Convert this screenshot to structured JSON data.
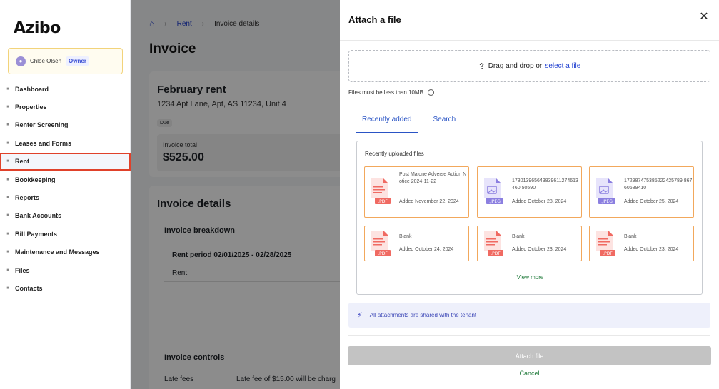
{
  "sidebar": {
    "logo": "Azibo",
    "user": {
      "name": "Chloe Olsen",
      "role": "Owner",
      "avatar_icon": "user-avatar-icon"
    },
    "items": [
      {
        "label": "Dashboard",
        "icon": "home-icon"
      },
      {
        "label": "Properties",
        "icon": "building-icon"
      },
      {
        "label": "Renter Screening",
        "icon": "user-search-icon"
      },
      {
        "label": "Leases and Forms",
        "icon": "document-icon"
      },
      {
        "label": "Rent",
        "icon": "chart-icon",
        "active": true
      },
      {
        "label": "Bookkeeping",
        "icon": "ledger-icon"
      },
      {
        "label": "Reports",
        "icon": "report-icon"
      },
      {
        "label": "Bank Accounts",
        "icon": "bank-icon"
      },
      {
        "label": "Bill Payments",
        "icon": "bill-icon"
      },
      {
        "label": "Maintenance and Messages",
        "icon": "wrench-icon"
      },
      {
        "label": "Files",
        "icon": "folder-icon"
      },
      {
        "label": "Contacts",
        "icon": "contacts-icon"
      }
    ]
  },
  "main": {
    "breadcrumb": {
      "home_icon": "home-icon",
      "rent": "Rent",
      "current": "Invoice details"
    },
    "page_title": "Invoice",
    "summary": {
      "title": "February rent",
      "address": "1234 Apt Lane, Apt, AS 11234, Unit 4",
      "status": "Due",
      "total_label": "Invoice total",
      "total_value": "$525.00"
    },
    "details": {
      "title": "Invoice details",
      "breakdown": "Invoice breakdown",
      "period": "Rent period 02/01/2025 - 02/28/2025",
      "rent_label": "Rent",
      "controls": "Invoice controls",
      "late_fees_label": "Late fees",
      "late_fees_value": "Late fee of $15.00 will be charg"
    }
  },
  "drawer": {
    "title": "Attach a file",
    "close_icon": "close-icon",
    "dropzone": {
      "text": "Drag and drop or",
      "link": "select a file",
      "icon": "upload-icon"
    },
    "size_note": "Files must be less than 10MB.",
    "tabs": [
      "Recently added",
      "Search"
    ],
    "active_tab": "Recently added",
    "panel_title": "Recently uploaded files",
    "files": [
      {
        "name": "Post Malone Adverse Action Notice 2024-11-22",
        "date": "Added November 22, 2024",
        "type": "PDF"
      },
      {
        "name": "173013965643839611274613460 50590",
        "date": "Added October 28, 2024",
        "type": "JPEG"
      },
      {
        "name": "172987475385222425789 86760689410",
        "date": "Added October 25, 2024",
        "type": "JPEG"
      },
      {
        "name": "Blank",
        "date": "Added October 24, 2024",
        "type": "PDF"
      },
      {
        "name": "Blank",
        "date": "Added October 23, 2024",
        "type": "PDF"
      },
      {
        "name": "Blank",
        "date": "Added October 23, 2024",
        "type": "PDF"
      }
    ],
    "view_more": "View more",
    "notice": "All attachments are shared with the tenant",
    "notice_icon": "bolt-icon",
    "attach_button": "Attach file",
    "cancel": "Cancel",
    "colors": {
      "accent": "#2a54c5",
      "card_border": "#f2a85c",
      "pdf": "#f06a62",
      "jpeg": "#8b7fe0"
    }
  }
}
